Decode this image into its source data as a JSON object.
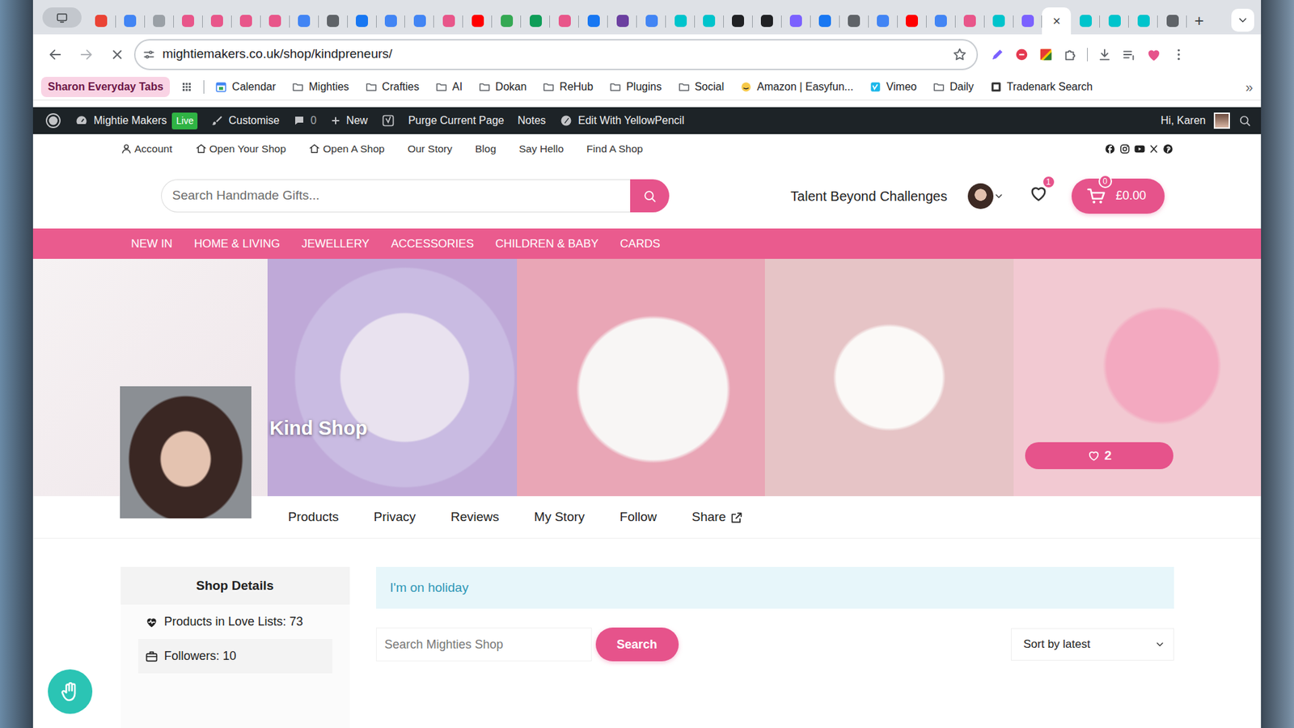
{
  "browser": {
    "tabs": [
      {
        "color": "#ea4335",
        "selected": false
      },
      {
        "color": "#4285f4",
        "selected": false
      },
      {
        "color": "#9aa0a6",
        "selected": false
      },
      {
        "color": "#e8568a",
        "selected": false
      },
      {
        "color": "#e8568a",
        "selected": false
      },
      {
        "color": "#e8568a",
        "selected": false
      },
      {
        "color": "#e8568a",
        "selected": false
      },
      {
        "color": "#4285f4",
        "selected": false
      },
      {
        "color": "#5f6368",
        "selected": false
      },
      {
        "color": "#1877f2",
        "selected": false
      },
      {
        "color": "#4285f4",
        "selected": false
      },
      {
        "color": "#4285f4",
        "selected": false
      },
      {
        "color": "#e8568a",
        "selected": false
      },
      {
        "color": "#ff0000",
        "selected": false
      },
      {
        "color": "#34a853",
        "selected": false
      },
      {
        "color": "#0f9d58",
        "selected": false
      },
      {
        "color": "#e8568a",
        "selected": false
      },
      {
        "color": "#1877f2",
        "selected": false
      },
      {
        "color": "#6b3fa0",
        "selected": false
      },
      {
        "color": "#4285f4",
        "selected": false
      },
      {
        "color": "#00c4cc",
        "selected": false
      },
      {
        "color": "#00c4cc",
        "selected": false
      },
      {
        "color": "#202124",
        "selected": false
      },
      {
        "color": "#202124",
        "selected": false
      },
      {
        "color": "#7b61ff",
        "selected": false
      },
      {
        "color": "#1877f2",
        "selected": false
      },
      {
        "color": "#5f6368",
        "selected": false
      },
      {
        "color": "#4285f4",
        "selected": false
      },
      {
        "color": "#ff0000",
        "selected": false
      },
      {
        "color": "#4285f4",
        "selected": false
      },
      {
        "color": "#e8568a",
        "selected": false
      },
      {
        "color": "#00c4cc",
        "selected": false
      },
      {
        "color": "#7b61ff",
        "selected": false
      },
      {
        "selected": true
      },
      {
        "color": "#00c4cc",
        "selected": false
      },
      {
        "color": "#00c4cc",
        "selected": false
      },
      {
        "color": "#00c4cc",
        "selected": false
      },
      {
        "color": "#5f6368",
        "selected": false
      }
    ],
    "close_tab": "×",
    "new_tab": "+",
    "url": "mightiemakers.co.uk/shop/kindpreneurs/",
    "tab_group": "Sharon Everyday Tabs",
    "bookmarks": [
      {
        "label": "Calendar",
        "kind": "calendar"
      },
      {
        "label": "Mighties",
        "kind": "folder"
      },
      {
        "label": "Crafties",
        "kind": "folder"
      },
      {
        "label": "AI",
        "kind": "folder"
      },
      {
        "label": "Dokan",
        "kind": "folder"
      },
      {
        "label": "ReHub",
        "kind": "folder"
      },
      {
        "label": "Plugins",
        "kind": "folder"
      },
      {
        "label": "Social",
        "kind": "folder"
      },
      {
        "label": "Amazon | Easyfun...",
        "kind": "amazon"
      },
      {
        "label": "Vimeo",
        "kind": "vimeo"
      },
      {
        "label": "Daily",
        "kind": "folder"
      },
      {
        "label": "Tradenark Search",
        "kind": "trademark"
      }
    ],
    "more_bookmarks": "»"
  },
  "admin_bar": {
    "site": "Mightie Makers",
    "status": "Live",
    "customise": "Customise",
    "comments": "0",
    "new": "New",
    "links": [
      "Purge Current Page",
      "Notes"
    ],
    "editor": "Edit With YellowPencil",
    "greeting": "Hi, Karen"
  },
  "top_nav": [
    {
      "label": "Account",
      "kind": "user"
    },
    {
      "label": "Open Your Shop",
      "kind": "home"
    },
    {
      "label": "Open A Shop",
      "kind": "home"
    },
    {
      "label": "Our Story",
      "kind": "plain"
    },
    {
      "label": "Blog",
      "kind": "plain"
    },
    {
      "label": "Say Hello",
      "kind": "plain"
    },
    {
      "label": "Find A Shop",
      "kind": "plain"
    }
  ],
  "header": {
    "search_placeholder": "Search Handmade Gifts...",
    "tagline": "Talent Beyond Challenges",
    "wishlist_count": "1",
    "cart_count": "0",
    "cart_total": "£0.00"
  },
  "menu": [
    "NEW IN",
    "HOME & LIVING",
    "JEWELLERY",
    "ACCESSORIES",
    "CHILDREN & BABY",
    "CARDS"
  ],
  "banner": {
    "shop_name": "Kind Shop",
    "likes": "2"
  },
  "shop_tabs": [
    {
      "label": "Products",
      "kind": "plain"
    },
    {
      "label": "Privacy",
      "kind": "plain"
    },
    {
      "label": "Reviews",
      "kind": "plain"
    },
    {
      "label": "My Story",
      "kind": "plain"
    },
    {
      "label": "Follow",
      "kind": "plain"
    },
    {
      "label": "Share",
      "kind": "external"
    }
  ],
  "sidebar": {
    "title": "Shop Details",
    "stats": [
      {
        "label": "Products in Love Lists: 73",
        "kind": "love"
      },
      {
        "label": "Followers: 10",
        "kind": "followers"
      }
    ]
  },
  "notice": "I'm on holiday",
  "shop_search": {
    "placeholder": "Search Mighties Shop",
    "button": "Search",
    "sort": "Sort by latest"
  }
}
